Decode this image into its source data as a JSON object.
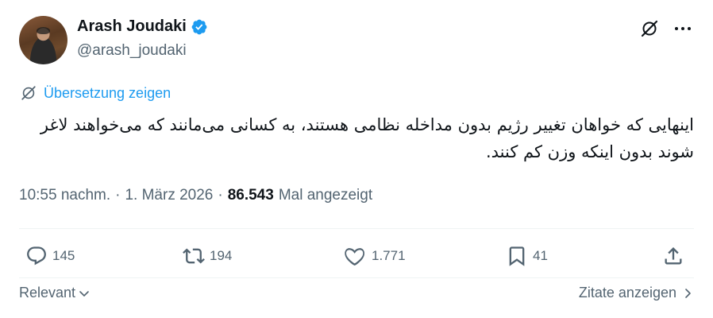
{
  "author": {
    "display_name": "Arash Joudaki",
    "handle": "@arash_joudaki",
    "verified": true
  },
  "translate": {
    "label": "Übersetzung zeigen"
  },
  "tweet": {
    "text": "اینهایی که خواهان تغییر رژیم بدون مداخله نظامی هستند، به کسانی می‌مانند که می‌خواهند لاغر شوند بدون اینکه وزن کم کنند."
  },
  "meta": {
    "time": "10:55 nachm.",
    "date": "1. März 2026",
    "views": "86.543",
    "views_label": "Mal angezeigt"
  },
  "actions": {
    "replies": "145",
    "reposts": "194",
    "likes": "1.771",
    "bookmarks": "41"
  },
  "footer": {
    "sort_label": "Relevant",
    "quotes_label": "Zitate anzeigen"
  },
  "colors": {
    "text": "#0f1419",
    "secondary": "#536471",
    "accent": "#1d9bf0",
    "divider": "#eff3f4"
  },
  "icons": [
    "verified-badge-icon",
    "grok-icon",
    "more-icon",
    "translate-icon",
    "reply-icon",
    "repost-icon",
    "like-icon",
    "bookmark-icon",
    "share-icon",
    "chevron-down-icon",
    "chevron-right-icon"
  ]
}
